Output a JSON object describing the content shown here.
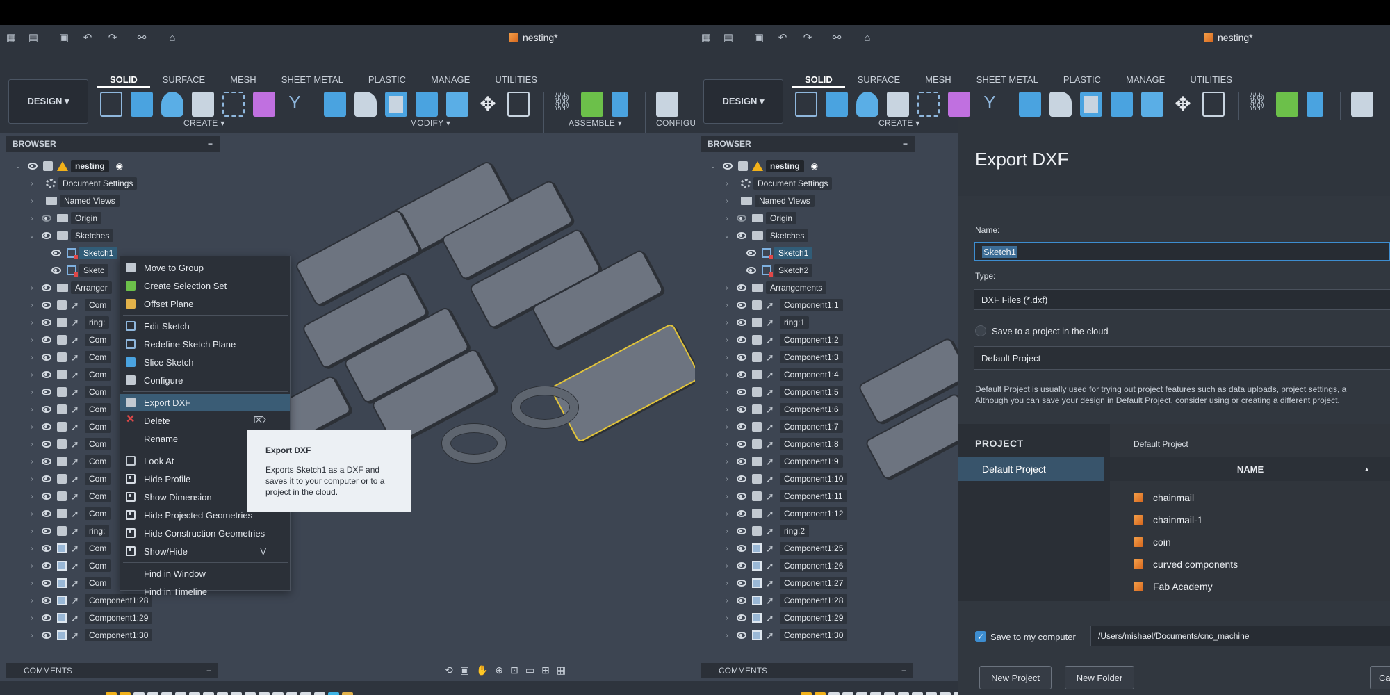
{
  "toolbar": {
    "doc_title": "nesting*",
    "design_label": "DESIGN ▾",
    "tabs": [
      "SOLID",
      "SURFACE",
      "MESH",
      "SHEET METAL",
      "PLASTIC",
      "MANAGE",
      "UTILITIES"
    ],
    "groups": [
      "CREATE ▾",
      "MODIFY ▾",
      "ASSEMBLE ▾",
      "CONFIGU"
    ]
  },
  "browser": {
    "title": "BROWSER",
    "root": "nesting",
    "items": [
      "Document Settings",
      "Named Views",
      "Origin",
      "Sketches",
      "Sketch1",
      "Sketch2",
      "Arrangements"
    ],
    "components": [
      "Component1:1",
      "ring:1",
      "Component1:2",
      "Component1:3",
      "Component1:4",
      "Component1:5",
      "Component1:6",
      "Component1:7",
      "Component1:8",
      "Component1:9",
      "Component1:10",
      "Component1:11",
      "Component1:12",
      "ring:2",
      "Component1:25",
      "Component1:26",
      "Component1:27",
      "Component1:28",
      "Component1:29",
      "Component1:30"
    ]
  },
  "left_labels": {
    "arrangements_short": "Arranger",
    "sketch2_short": "Sketc",
    "comp_short": "Com",
    "ring_short": "ring:",
    "c28": "Component1:28",
    "c29": "Component1:29",
    "c30": "Component1:30"
  },
  "context_menu": [
    "Move to Group",
    "Create Selection Set",
    "Offset Plane",
    "Edit Sketch",
    "Redefine Sketch Plane",
    "Slice Sketch",
    "Configure",
    "Export DXF",
    "Delete",
    "Rename",
    "Look At",
    "Hide Profile",
    "Show Dimension",
    "Hide Projected Geometries",
    "Hide Construction Geometries",
    "Show/Hide",
    "Find in Window",
    "Find in Timeline"
  ],
  "context_menu_shortcut": "V",
  "tooltip": {
    "title": "Export DXF",
    "body": "Exports Sketch1 as a DXF and saves it to your computer or to a project in the cloud."
  },
  "comments": "COMMENTS",
  "dialog": {
    "title": "Export DXF",
    "name_label": "Name:",
    "name_value": "Sketch1",
    "type_label": "Type:",
    "type_value": "DXF Files (*.dxf)",
    "cloud_label": "Save to a project in the cloud",
    "project_value": "Default Project",
    "note_line1": "Default Project is usually used for trying out project features such as data uploads, project settings, a",
    "note_line2": "Although you can save your design in Default Project, consider using or creating a different project.",
    "project_header": "PROJECT",
    "project_selected": "Default Project",
    "crumb": "Default Project",
    "name_header": "NAME",
    "projects": [
      "chainmail",
      "chainmail-1",
      "coin",
      "curved components",
      "Fab Academy"
    ],
    "save_local_label": "Save to my computer",
    "save_path": "/Users/mishael/Documents/cnc_machine",
    "new_project": "New Project",
    "new_folder": "New Folder",
    "cancel_short": "Ca"
  }
}
